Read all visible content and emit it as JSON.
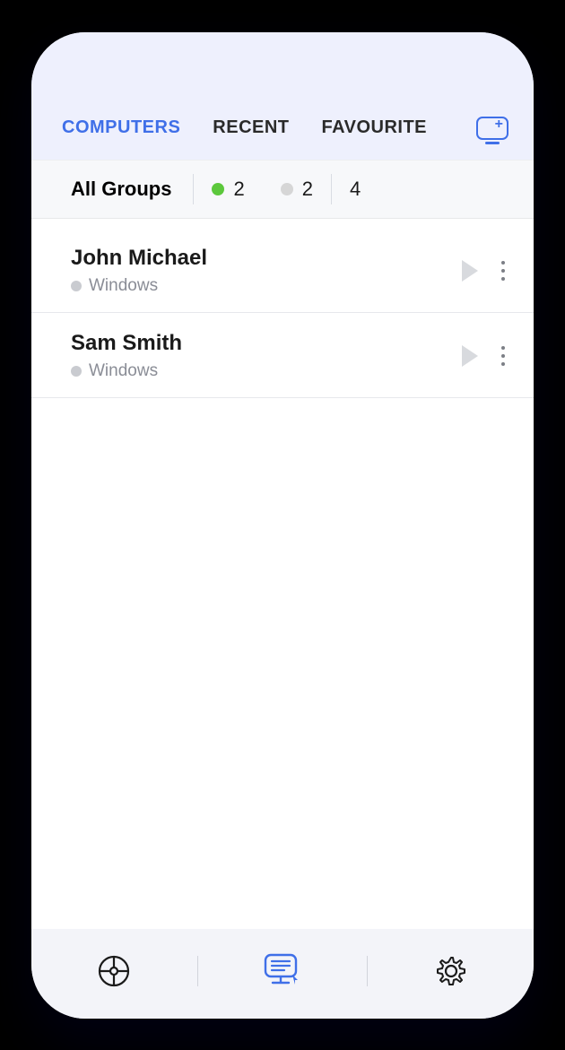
{
  "colors": {
    "accent": "#3f6fe8",
    "online": "#5cc83c",
    "offline": "#d6d6d6"
  },
  "tabs": {
    "computers": "COMPUTERS",
    "recent": "RECENT",
    "favourite": "FAVOURITE",
    "active": "computers"
  },
  "filter": {
    "group_label": "All Groups",
    "online_count": "2",
    "offline_count": "2",
    "total_count": "4"
  },
  "computers": [
    {
      "name": "John Michael",
      "os": "Windows"
    },
    {
      "name": "Sam Smith",
      "os": "Windows"
    }
  ],
  "nav": {
    "remote": "remote",
    "computers": "computers",
    "settings": "settings",
    "active": "computers"
  }
}
